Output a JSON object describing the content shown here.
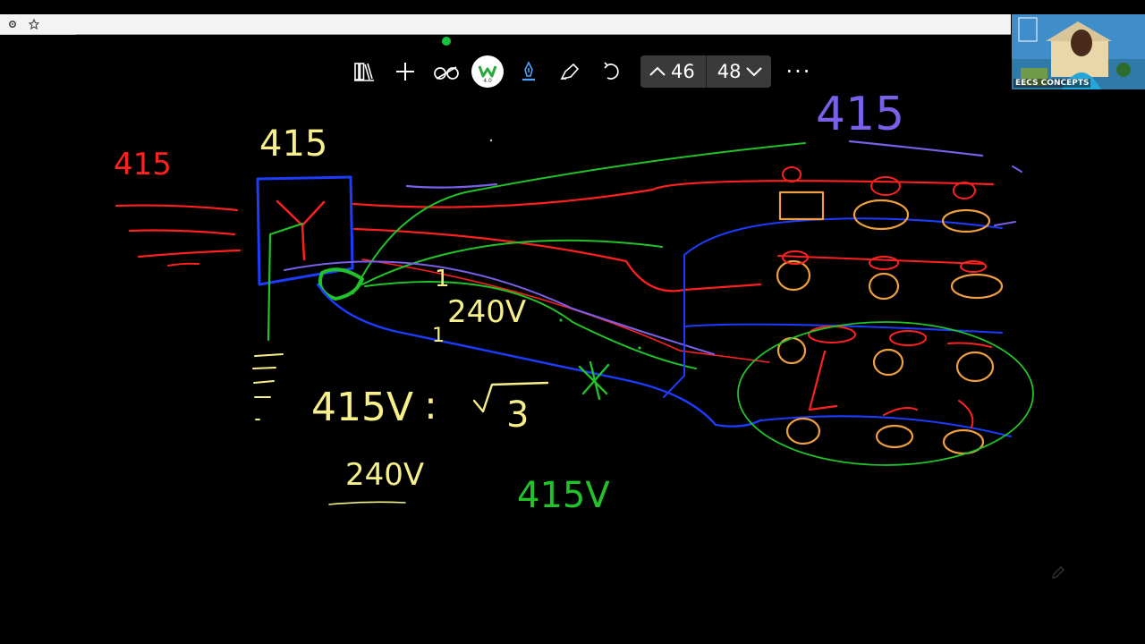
{
  "browser": {
    "icons": [
      "gear-icon",
      "star-icon"
    ]
  },
  "toolbar": {
    "tools": [
      "library-icon",
      "add-icon",
      "eraser-icon",
      "logo-icon",
      "pen-icon",
      "highlighter-icon",
      "undo-icon"
    ],
    "logo_version": "4.0",
    "page_prev_label": "46",
    "page_next_label": "48",
    "more_label": "···"
  },
  "webcam": {
    "label": "EECS CONCEPTS"
  },
  "colors": {
    "red": "#ff2020",
    "yellow": "#f7f08a",
    "green": "#22c22a",
    "blue": "#1c3cff",
    "purple": "#7a60e8",
    "orange": "#f0a040"
  },
  "drawing": {
    "label_415_red": "415",
    "label_415_yellow": "415",
    "label_415_purple": "415",
    "label_240v": "240V",
    "label_415v": "415V",
    "label_colon": ":",
    "label_3": "3",
    "label_240v_bottom": "240V",
    "label_415v_green": "415V",
    "label_1a": "1",
    "label_1b": "1"
  }
}
